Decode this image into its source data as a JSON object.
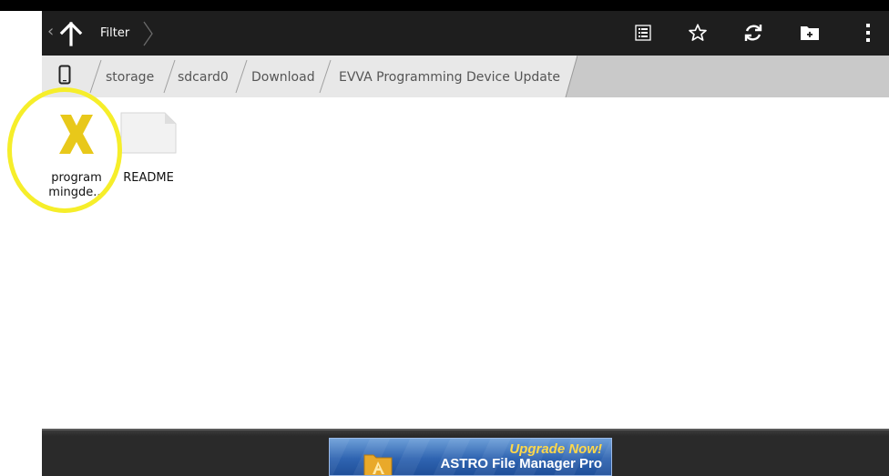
{
  "actionbar": {
    "back_chevron": "‹",
    "filter_label": "Filter",
    "icons": [
      "up-arrow-icon",
      "list-view-icon",
      "star-icon",
      "refresh-icon",
      "new-folder-icon",
      "overflow-menu-icon"
    ]
  },
  "breadcrumb": {
    "items": [
      "storage",
      "sdcard0",
      "Download",
      "EVVA Programming Device Update"
    ]
  },
  "files": [
    {
      "line1": "program",
      "line2": "mingde...",
      "icon": "x-app-icon"
    },
    {
      "line1": "README",
      "icon": "document-icon"
    }
  ],
  "ad": {
    "line1": "Upgrade Now!",
    "line2": "ASTRO File Manager Pro"
  },
  "colors": {
    "actionbar": "#1e1e1e",
    "breadcrumb_active": "#e8e8e8",
    "breadcrumb_rest": "#c9c9c9",
    "highlight_ring": "#f6ee2a",
    "x_icon": "#e8c81a"
  }
}
